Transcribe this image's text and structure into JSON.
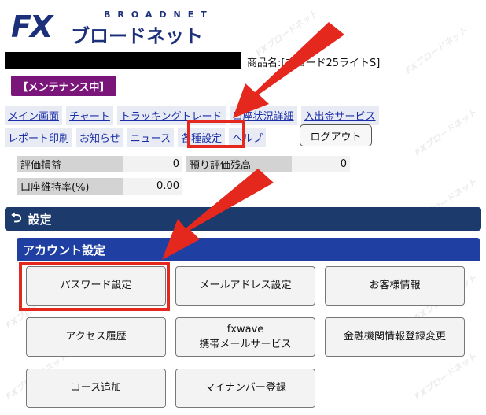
{
  "logo": {
    "fx": "FX",
    "broadnet": "BROADNET",
    "jp": "ブロードネット",
    "watermark": "FXブロードネット"
  },
  "product": "商品名:[ブロード25ライトS]",
  "maintenance": "【メンテナンス中】",
  "nav_row1": [
    "メイン画面",
    "チャート",
    "トラッキングトレード",
    "口座状況詳細",
    "入出金サービス"
  ],
  "nav_row2": [
    "レポート印刷",
    "お知らせ",
    "ニュース",
    "各種設定",
    "ヘルプ"
  ],
  "logout": "ログアウト",
  "stats": {
    "pl_label": "評価損益",
    "pl_value": "0",
    "deposit_label": "預り評価残高",
    "deposit_value": "0",
    "margin_label": "口座維持率(%)",
    "margin_value": "0.00"
  },
  "section": {
    "title": "設定",
    "subtitle": "アカウント設定"
  },
  "buttons": {
    "password": "パスワード設定",
    "email": "メールアドレス設定",
    "customer": "お客様情報",
    "access": "アクセス履歴",
    "fxwave_1": "fxwave",
    "fxwave_2": "携帯メールサービス",
    "bank": "金融機関情報登録変更",
    "course": "コース追加",
    "mynumber": "マイナンバー登録"
  },
  "colors": {
    "navy": "#1c3a6b",
    "blue": "#1f3fa3",
    "highlight": "#e5281e",
    "maint": "#7a157a"
  }
}
